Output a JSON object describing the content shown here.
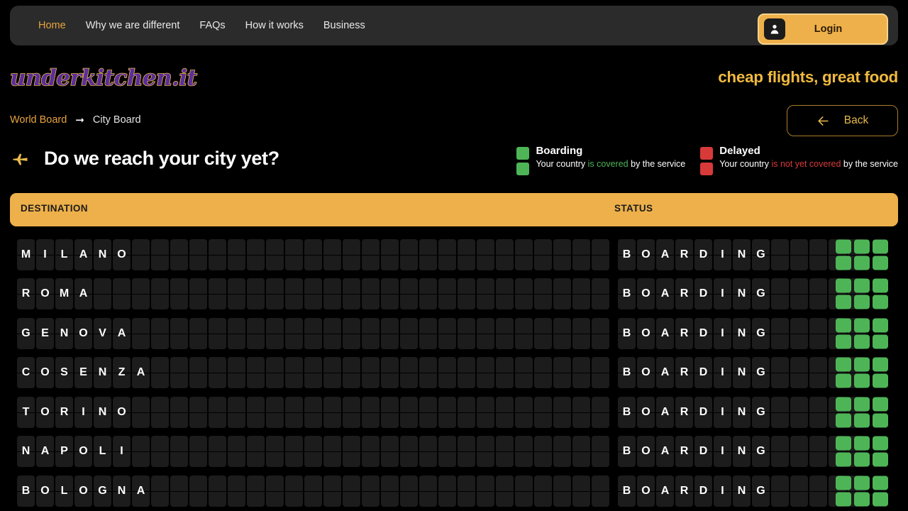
{
  "navbar": {
    "links": [
      {
        "label": "Home",
        "active": true
      },
      {
        "label": "Why we are different",
        "active": false
      },
      {
        "label": "FAQs",
        "active": false
      },
      {
        "label": "How it works",
        "active": false
      },
      {
        "label": "Business",
        "active": false
      }
    ],
    "login_label": "Login",
    "login_icon": "user-icon",
    "background": "#2b2b2b",
    "accent": "#e8a33d"
  },
  "brand": {
    "name": "underkitchen.it",
    "color": "#5b2d9b",
    "outline": "#e8b94a",
    "tagline": "cheap flights, great food",
    "tagline_color": "#f0b93f"
  },
  "breadcrumb": {
    "parent": "World Board",
    "arrow_icon": "arrow-right-icon",
    "current": "City Board"
  },
  "back_button": {
    "label": "Back",
    "icon": "arrow-left-icon",
    "color": "#e8b94a"
  },
  "heading": {
    "icon": "airplane-icon",
    "text": "Do we reach your city yet?"
  },
  "legend": [
    {
      "title": "Boarding",
      "swatch_color": "#4eb557",
      "desc_prefix": "Your country ",
      "desc_highlight": "is covered",
      "desc_suffix": " by the service",
      "highlight_class": "hl-green"
    },
    {
      "title": "Delayed",
      "swatch_color": "#d83a3a",
      "desc_prefix": "Your country ",
      "desc_highlight": "is not yet covered",
      "desc_suffix": " by the service",
      "highlight_class": "hl-red"
    }
  ],
  "table": {
    "header_background": "#eeb04a",
    "columns": [
      {
        "label": "DESTINATION"
      },
      {
        "label": "STATUS"
      }
    ],
    "dest_flap_count": 31,
    "status_flap_count": 13,
    "rows": [
      {
        "destination": "MILANO",
        "status": "BOARDING",
        "indicator": "green"
      },
      {
        "destination": "ROMA",
        "status": "BOARDING",
        "indicator": "green"
      },
      {
        "destination": "GENOVA",
        "status": "BOARDING",
        "indicator": "green"
      },
      {
        "destination": "COSENZA",
        "status": "BOARDING",
        "indicator": "green"
      },
      {
        "destination": "TORINO",
        "status": "BOARDING",
        "indicator": "green"
      },
      {
        "destination": "NAPOLI",
        "status": "BOARDING",
        "indicator": "green"
      },
      {
        "destination": "BOLOGNA",
        "status": "BOARDING",
        "indicator": "green"
      }
    ]
  }
}
